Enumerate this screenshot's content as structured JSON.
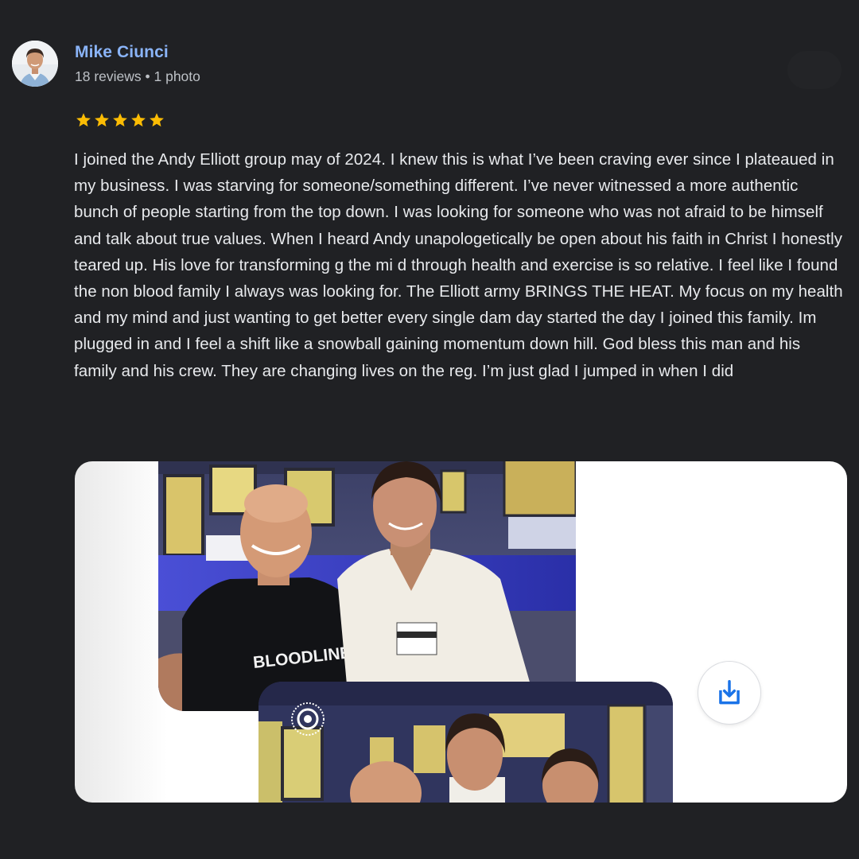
{
  "author": {
    "name": "Mike Ciunci",
    "meta": "18 reviews • 1 photo"
  },
  "rating": {
    "value": 5,
    "max": 5,
    "star_color": "#fbbc04"
  },
  "review": {
    "text": "I joined the Andy Elliott group may of 2024. I knew this is what I’ve been craving ever since I plateaued in my business. I was starving for someone/something different. I’ve never witnessed a more authentic bunch of people starting from the top down. I was looking for someone who was not afraid to be himself and talk about true values. When I heard Andy unapologetically be open about his faith in Christ I honestly teared up. His love for transforming g the mi d through health and exercise is so relative. I feel like I found the non blood family I always was looking for. The Elliott army BRINGS THE HEAT. My focus on my health and my mind and just wanting to get better every single dam day started the day I joined this family. Im plugged in and I feel a shift like a snowball gaining momentum down hill. God bless this man and his family and his crew. They are changing lives on the reg. I’m just glad I jumped in when I did"
  },
  "photos": {
    "shirt_text": "BLOODLINE BREAKER",
    "download_icon": "download-icon"
  },
  "colors": {
    "background": "#202124",
    "author_link": "#8ab4f8",
    "text": "#e8eaed",
    "meta": "#bdc1c6",
    "accent_blue": "#1a73e8"
  }
}
